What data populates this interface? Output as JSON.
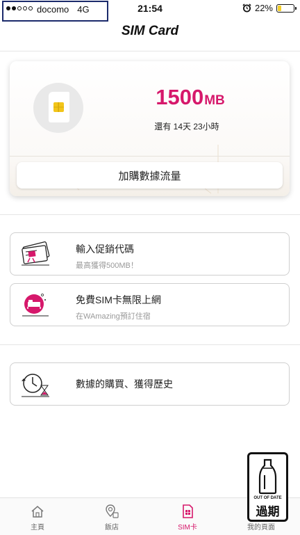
{
  "status_bar": {
    "carrier": "docomo",
    "network": "4G",
    "time": "21:54",
    "battery": "22%",
    "battery_level": 0.22,
    "signal_bars_filled": 2,
    "signal_bars_total": 5
  },
  "header": {
    "title": "SIM Card"
  },
  "sim_card": {
    "data_number": "1500",
    "data_unit": "MB",
    "remaining": "還有 14天 23小時",
    "buy_button_label": "加購數據流量"
  },
  "menu": {
    "items": [
      {
        "title": "輸入促銷代碼",
        "subtitle": "最高獲得500MB！",
        "icon": "promo-ticket-icon"
      },
      {
        "title": "免費SIM卡無限上網",
        "subtitle": "在WAmazing預訂住宿",
        "icon": "hotel-bed-icon"
      },
      {
        "title": "數據的購買、獲得歷史",
        "icon": "history-clock-icon"
      }
    ]
  },
  "bottom_nav": {
    "items": [
      {
        "label": "主頁",
        "icon": "home-icon"
      },
      {
        "label": "飯店",
        "icon": "hotel-icon"
      },
      {
        "label": "SIM卡",
        "icon": "sim-card-icon",
        "active": true
      },
      {
        "label": "我的頁面",
        "icon": "user-icon"
      }
    ]
  },
  "stamp": {
    "text": "OUT OF DATE",
    "kanji": "過期"
  },
  "colors": {
    "accent": "#d6186b",
    "carrier_box_border": "#1b2a6b",
    "battery": "#f4cf2a",
    "chip_gold": "#f2c51a"
  }
}
